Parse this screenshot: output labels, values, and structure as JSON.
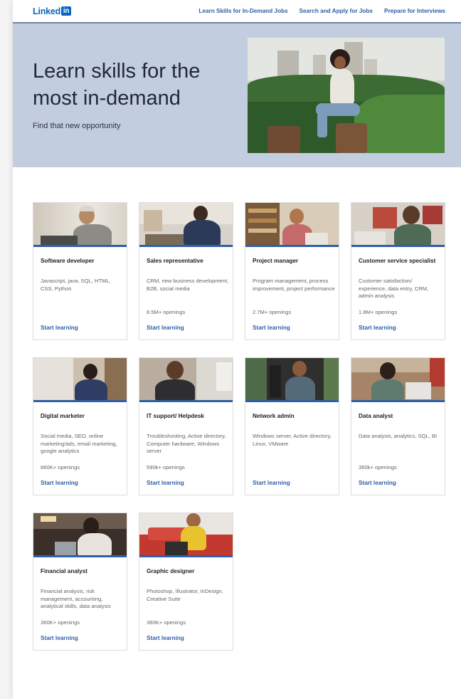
{
  "brand": {
    "word": "Linked",
    "box": "in",
    "color": "#0a66c2"
  },
  "nav": {
    "links": [
      "Learn Skills for In-Demand Jobs",
      "Search and Apply for Jobs",
      "Prepare for Interviews"
    ]
  },
  "hero": {
    "title": "Learn skills for the most in-demand",
    "subtitle": "Find that new opportunity",
    "background": "#c3cde0"
  },
  "cards": [
    {
      "title": "Software developer",
      "skills": "Javascript, java, SQL, HTML, CSS, Python",
      "openings": "",
      "link": "Start learning"
    },
    {
      "title": "Sales representative",
      "skills": "CRM, new business development, B2B, social media",
      "openings": "8.5M+ openings",
      "link": "Start learning"
    },
    {
      "title": "Project manager",
      "skills": "Program management, process improvement, project performance",
      "openings": "2.7M+ openings",
      "link": "Start learning"
    },
    {
      "title": "Customer service specialist",
      "skills": "Customer satisfaction/ experience, data entry, CRM, admin analysis",
      "openings": "1.8M+ openings",
      "link": "Start learning"
    },
    {
      "title": "Digital marketer",
      "skills": "Social media, SEO, online marketing/ads, email marketing, google analytics",
      "openings": "860K+ openings",
      "link": "Start learning"
    },
    {
      "title": "IT support/ Helpdesk",
      "skills": "Troubleshooting, Active directory, Computer hardware, Windows server",
      "openings": "590k+ openings",
      "link": "Start learning"
    },
    {
      "title": "Network admin",
      "skills": "Windows server, Active directory, Linux, VMware",
      "openings": "",
      "link": "Start learning"
    },
    {
      "title": "Data analyst",
      "skills": "Data analysis, analytics, SQL, BI",
      "openings": "360k+ openings",
      "link": "Start learning"
    },
    {
      "title": "Financial analyst",
      "skills": "Financial analysis, risk management, accounting, analytical skills, data analysis",
      "openings": "360K+ openings",
      "link": "Start learning"
    },
    {
      "title": "Graphic designer",
      "skills": "Photoshop, Illustrator, InDesign, Creative Suite",
      "openings": "360K+ openings",
      "link": "Start learning"
    }
  ],
  "colors": {
    "accent": "#2f5fa8",
    "card_border": "#dcdcdc"
  }
}
